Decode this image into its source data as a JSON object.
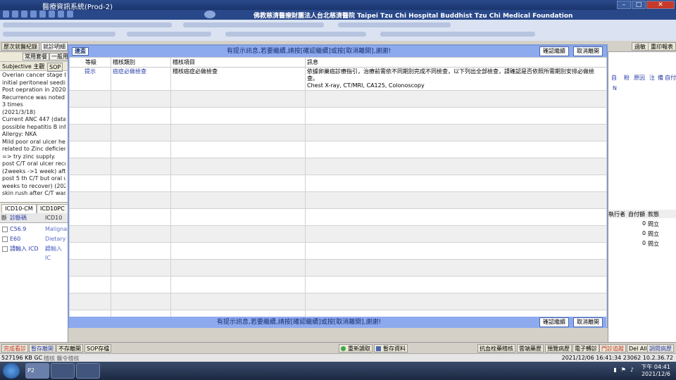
{
  "window": {
    "title": "醫療資訊系統(Prod-2)",
    "controls": [
      "–",
      "□",
      "✕"
    ]
  },
  "banner": {
    "org_text": "佛教慈濟醫療財團法人台北慈濟醫院 Taipei Tzu Chi Hospital Buddhist Tzu Chi Medical Foundation"
  },
  "toolbar": {
    "tabs": [
      "歷次就醫紀錄",
      "就診明細"
    ],
    "right_buttons": [
      "過敏",
      "重印報表"
    ]
  },
  "left_panel": {
    "buttons": [
      "常用套餐",
      "一般用"
    ],
    "subjective_label": "Subjective 主觀",
    "sop_label": "SOP",
    "notes": [
      "Overian cancer stage III",
      "initial peritoneal seeding",
      "Post oepration in 2020 J",
      "Recurrence was noted a",
      "3 times",
      "(2021/3/18)",
      "Current ANC 447 (data fr",
      "possible hepatitis B infe",
      "Allergy: NKA",
      "Mild poor oral ulcer heali",
      "related to Zinc deficiency",
      "=> try zinc supply.",
      "post C/T oral ulcer recov",
      "(2weeks ->1 week) after Z",
      "post 5 th C/T but oral ulc",
      "weeks to recover) (2021/",
      "skin rush after C/T was r"
    ],
    "icd_tabs": [
      "ICD10-CM",
      "ICD10PC"
    ],
    "icd_headers": [
      "斷",
      "診斷碼",
      "ICD10"
    ],
    "icd_rows": [
      {
        "code": "C56.9",
        "desc": "Malignan"
      },
      {
        "code": "E60",
        "desc": "Dietary z"
      },
      {
        "code": "請輸入 ICD",
        "desc": "請輸入 IC"
      }
    ]
  },
  "right_panel": {
    "headers": [
      "自",
      "粉",
      "原因",
      "注",
      "備",
      "自付"
    ],
    "flag": "N",
    "headers2": [
      "執行者",
      "自付額",
      "款態"
    ],
    "rows": [
      {
        "amount": "0",
        "status": "問立"
      },
      {
        "amount": "0",
        "status": "問立"
      },
      {
        "amount": "0",
        "status": "問立"
      }
    ]
  },
  "dialog": {
    "tag": "連盃",
    "message_top": "有提示訊息,若要繼續,請按[確認繼續]或按[取消離開],謝謝!",
    "message_bottom": "有提示訊息,若要繼續,請按[確認繼續]或按[取消離開],謝謝!",
    "confirm_label": "確認繼續",
    "cancel_label": "取消離開",
    "columns": [
      "等級",
      "稽核類別",
      "稽核項目",
      "訊息"
    ],
    "rows": [
      {
        "level": "提示",
        "category": "癌症必做檢查",
        "item": "稽核癌症必做檢查",
        "message_line1": "依據卵巢癌診療指引，治療前需依不同期別完成不同檢查，以下列出全部檢查，請確認是否依照所需期別安排必做檢查。",
        "message_line2": "Chest X-ray, CT/MRI, CA125, Colonoscopy"
      }
    ],
    "empty_rows": 14
  },
  "bottom_buttons": {
    "left": [
      "完成看診",
      "暫存離開",
      "不存離開",
      "SOP存檔"
    ],
    "center": [
      "重新讀取",
      "暫存資料"
    ],
    "right": [
      "抗血栓藥稽核",
      "雲端藥歷",
      "預覽病歷",
      "電子轉診",
      "門診追蹤",
      "Del All",
      "調閱病歷"
    ]
  },
  "statusbar": {
    "memory": "527196 KB GC",
    "left_text": "稽核 醫令稽核",
    "right_text": "2021/12/06 16:41:34  23062  10.2.36.72"
  },
  "taskbar": {
    "apps": [
      "",
      "P2",
      "",
      ""
    ],
    "time": "下午 04:41",
    "date": "2021/12/6"
  },
  "colors": {
    "dialog_bar": "#8eaaee",
    "title_blue": "#1b356c",
    "link_blue": "#2b3ea8"
  }
}
